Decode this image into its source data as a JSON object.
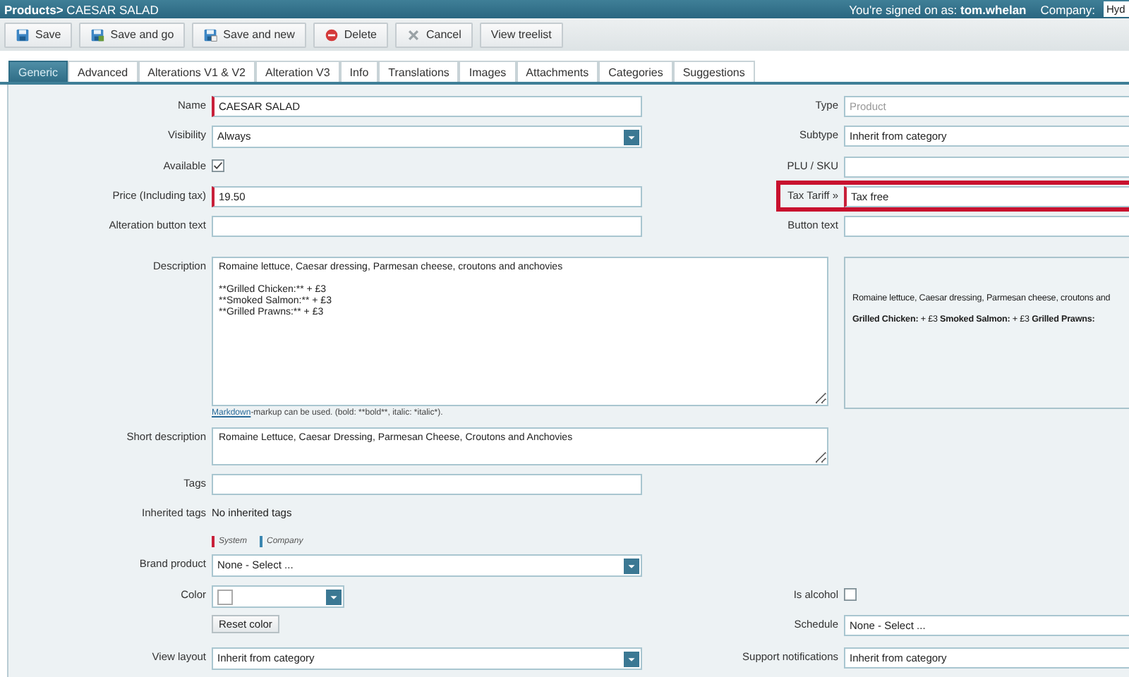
{
  "header": {
    "title": "**Products>** CAESAR SALAD",
    "signed_on": "You're signed on as: **tom.whelan**",
    "company_label": "Company:",
    "company_value": "Hyd"
  },
  "toolbar": [
    {
      "label": "Save",
      "kind": "save"
    },
    {
      "label": "Save and go",
      "kind": "save-go"
    },
    {
      "label": "Save and new",
      "kind": "save-new"
    },
    {
      "label": "Delete",
      "kind": "delete"
    },
    {
      "label": "Cancel",
      "kind": "cancel"
    },
    {
      "label": "View treelist",
      "kind": "plain"
    }
  ],
  "tabs": [
    {
      "label": "Generic",
      "selected": true
    },
    {
      "label": "Advanced",
      "selected": false
    },
    {
      "label": "Alterations V1 & V2",
      "selected": false
    },
    {
      "label": "Alteration V3",
      "selected": false
    },
    {
      "label": "Info",
      "selected": false
    },
    {
      "label": "Translations",
      "selected": false
    },
    {
      "label": "Images",
      "selected": false
    },
    {
      "label": "Attachments",
      "selected": false
    },
    {
      "label": "Categories",
      "selected": false
    },
    {
      "label": "Suggestions",
      "selected": false
    }
  ],
  "rows": [
    {
      "left": {
        "kind": "text",
        "label": "Name",
        "value": "CAESAR SALAD",
        "required": true
      },
      "right": {
        "kind": "text",
        "label": "Type",
        "value": "Product",
        "disabled": true
      }
    },
    {
      "left": {
        "kind": "select",
        "label": "Visibility",
        "value": "Always"
      },
      "right": {
        "kind": "text",
        "label": "Subtype",
        "value": "Inherit from category"
      }
    },
    {
      "left": {
        "kind": "checkbox",
        "label": "Available",
        "checked": true
      },
      "right": {
        "kind": "text",
        "label": "PLU / SKU"
      }
    },
    {
      "left": {
        "kind": "text",
        "label": "Price (Including tax)",
        "value": "19.50",
        "required": true
      },
      "right": {
        "kind": "text",
        "label": "Tax Tariff »",
        "value": "Tax free",
        "required": true,
        "highlighted": true
      }
    },
    {
      "left": {
        "kind": "text",
        "label": "Alteration button text"
      },
      "right": {
        "kind": "text",
        "label": "Button text"
      }
    },
    {
      "left": {
        "kind": "description",
        "label": "Description",
        "value": "Romaine lettuce, Caesar dressing, Parmesan cheese, croutons and anchovies\n\n**Grilled Chicken:** + £3\n**Smoked Salmon:** + £3\n**Grilled Prawns:** + £3"
      },
      "right": {
        "kind": "preview",
        "lines": [
          "Romaine lettuce, Caesar dressing, Parmesan cheese, croutons and",
          "**Grilled Chicken:** + £3 **Smoked Salmon:** + £3 **Grilled Prawns:**"
        ]
      }
    },
    {
      "left": {
        "kind": "note",
        "link": "Markdown",
        "text": "-markup can be used. (bold: **bold**, italic: *italic*)."
      }
    },
    {
      "left": {
        "kind": "shorttext",
        "label": "Short description",
        "value": "Romaine Lettuce, Caesar Dressing, Parmesan Cheese, Croutons and Anchovies"
      }
    },
    {
      "left": {
        "kind": "text",
        "label": "Tags"
      }
    },
    {
      "left": {
        "kind": "static",
        "label": "Inherited tags",
        "value": "No inherited tags"
      }
    },
    {
      "left": {
        "kind": "legend",
        "items": [
          {
            "label": "System",
            "color": "#c8203a"
          },
          {
            "label": "Company",
            "color": "#3a86b0"
          }
        ]
      }
    },
    {
      "left": {
        "kind": "select",
        "label": "Brand product",
        "value": "None - Select ..."
      }
    },
    {
      "left": {
        "kind": "color",
        "label": "Color"
      },
      "right": {
        "kind": "checkbox",
        "label": "Is alcohol",
        "checked": false
      }
    },
    {
      "left": {
        "kind": "button",
        "label": "Reset color"
      },
      "right": {
        "kind": "text",
        "label": "Schedule",
        "value": "None - Select ..."
      }
    },
    {
      "left": {
        "kind": "select",
        "label": "View layout",
        "value": "Inherit from category"
      },
      "right": {
        "kind": "text",
        "label": "Support notifications",
        "value": "Inherit from category"
      }
    }
  ]
}
